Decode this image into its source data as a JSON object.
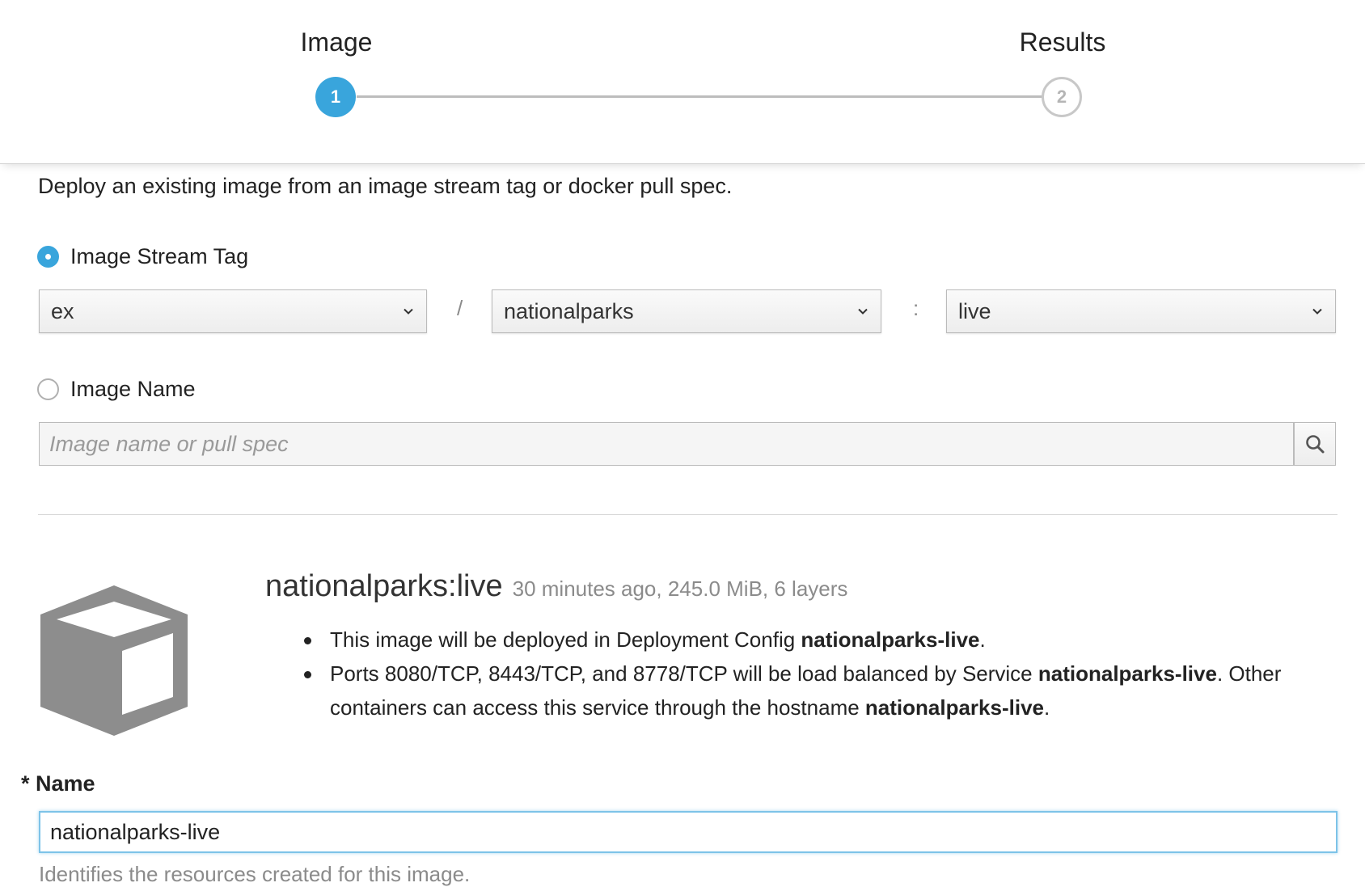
{
  "wizard": {
    "steps": [
      {
        "label": "Image",
        "number": "1",
        "state": "active"
      },
      {
        "label": "Results",
        "number": "2",
        "state": "pending"
      }
    ],
    "accent_color": "#39a5dc"
  },
  "intro": "Deploy an existing image from an image stream tag or docker pull spec.",
  "image_stream_tag": {
    "label": "Image Stream Tag",
    "selected": true,
    "namespace": "ex",
    "separator1": "/",
    "stream": "nationalparks",
    "separator2": ":",
    "tag": "live"
  },
  "image_name": {
    "label": "Image Name",
    "selected": false,
    "placeholder": "Image name or pull spec",
    "value": "",
    "search_icon": "search-icon"
  },
  "image_info": {
    "icon": "cube-icon",
    "name": "nationalparks:live",
    "meta": "30 minutes ago, 245.0 MiB, 6 layers",
    "bullet1": {
      "text": "This image will be deployed in Deployment Config ",
      "bold": "nationalparks-live",
      "end": "."
    },
    "bullet2": {
      "text1": "Ports 8080/TCP, 8443/TCP, and 8778/TCP will be load balanced by Service ",
      "bold1": "nationalparks-live",
      "text2": ". Other containers can access this service through the hostname ",
      "bold2": "nationalparks-live",
      "end": "."
    }
  },
  "name_field": {
    "required_mark": "*",
    "label": "Name",
    "value": "nationalparks-live",
    "help": "Identifies the resources created for this image."
  }
}
